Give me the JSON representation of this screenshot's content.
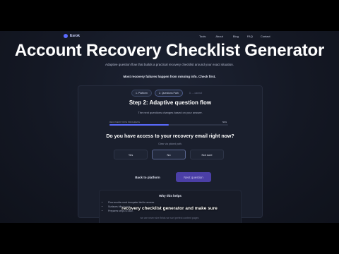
{
  "nav": {
    "logo": "Esrok",
    "links": [
      "Tools",
      "About",
      "Blog",
      "FAQ",
      "Contact"
    ]
  },
  "hero": {
    "title": "Account Recovery Checklist Generator",
    "subtitle": "Adaptive question flow that builds a practical recovery checklist around your exact situation.",
    "note": "Most recovery failures happen from missing info. Check first."
  },
  "card": {
    "steps": [
      "1. Platform",
      "2. Questions Path",
      "3. ... cannot"
    ],
    "heading": "Step 2: Adaptive question flow",
    "subheading": "The next questions changes based on your answer.",
    "progress_label": "RECOVERY PATH PROGRESS",
    "progress_percent": "50%",
    "progress_value": 0.5,
    "question": "Do you have access to your recovery email right now?",
    "question_hint": "Clear via picked path.",
    "answers": [
      "Yes",
      "No",
      "Not sure"
    ],
    "selected_answer": "No",
    "back_label": "Back to platform",
    "next_label": "Next question"
  },
  "why": {
    "title": "Why this helps",
    "items": [
      "Flow avoids most dumpster bin/for access.",
      "Surfaces blind spots.",
      "Prepares steps to take."
    ]
  },
  "caption": "recovery checklist generator and make sure",
  "footnote": "we are never sire fields we sort perfect content pages",
  "colors": {
    "accent": "#5b6bff",
    "primary_button": "#4b3fa6",
    "background": "#141824",
    "card": "#1a1f2d"
  }
}
